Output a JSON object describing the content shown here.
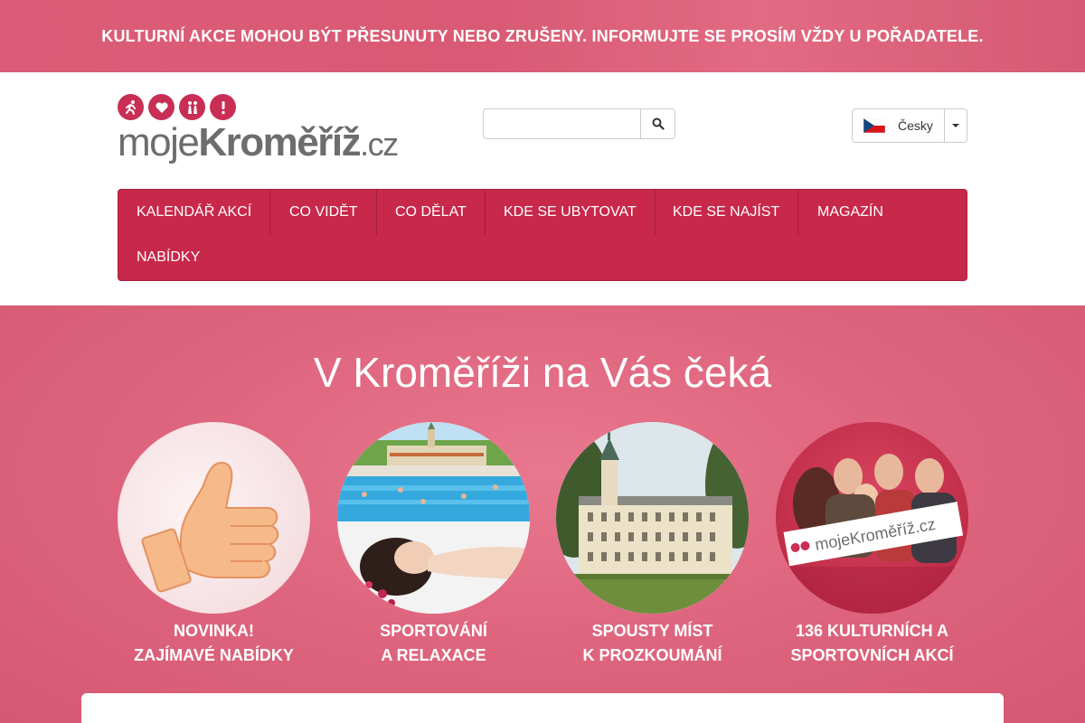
{
  "notice": {
    "text": "KULTURNÍ AKCE MOHOU BÝT PŘESUNUTY NEBO ZRUŠENY. INFORMUJTE SE PROSÍM VŽDY U POŘADATELE."
  },
  "logo": {
    "part1": "moje",
    "part2": "Kroměříž",
    "part3": ".cz",
    "icons": [
      "running-person-icon",
      "heart-icon",
      "couple-icon",
      "exclamation-icon"
    ]
  },
  "search": {
    "value": "",
    "placeholder": "",
    "icon": "search-icon"
  },
  "language": {
    "label": "Česky",
    "flag": "czech-flag-icon"
  },
  "nav": {
    "items": [
      "KALENDÁŘ AKCÍ",
      "CO VIDĚT",
      "CO DĚLAT",
      "KDE SE UBYTOVAT",
      "KDE SE NAJÍST",
      "MAGAZÍN",
      "NABÍDKY"
    ]
  },
  "hero": {
    "title": "V Kroměříži na Vás čeká",
    "features": [
      {
        "line1": "NOVINKA!",
        "line2": "ZAJÍMAVÉ NABÍDKY"
      },
      {
        "line1": "SPORTOVÁNÍ",
        "line2": "A RELAXACE"
      },
      {
        "line1": "SPOUSTY MÍST",
        "line2": "K PROZKOUMÁNÍ"
      },
      {
        "line1": "136 KULTURNÍCH A",
        "line2": "SPORTOVNÍCH AKCÍ"
      }
    ],
    "banner_logo": "mojeKroměříž.cz"
  },
  "colors": {
    "brand": "#c8284a",
    "hero_bg": "#df667f",
    "logo_grey": "#6d6d6d"
  }
}
